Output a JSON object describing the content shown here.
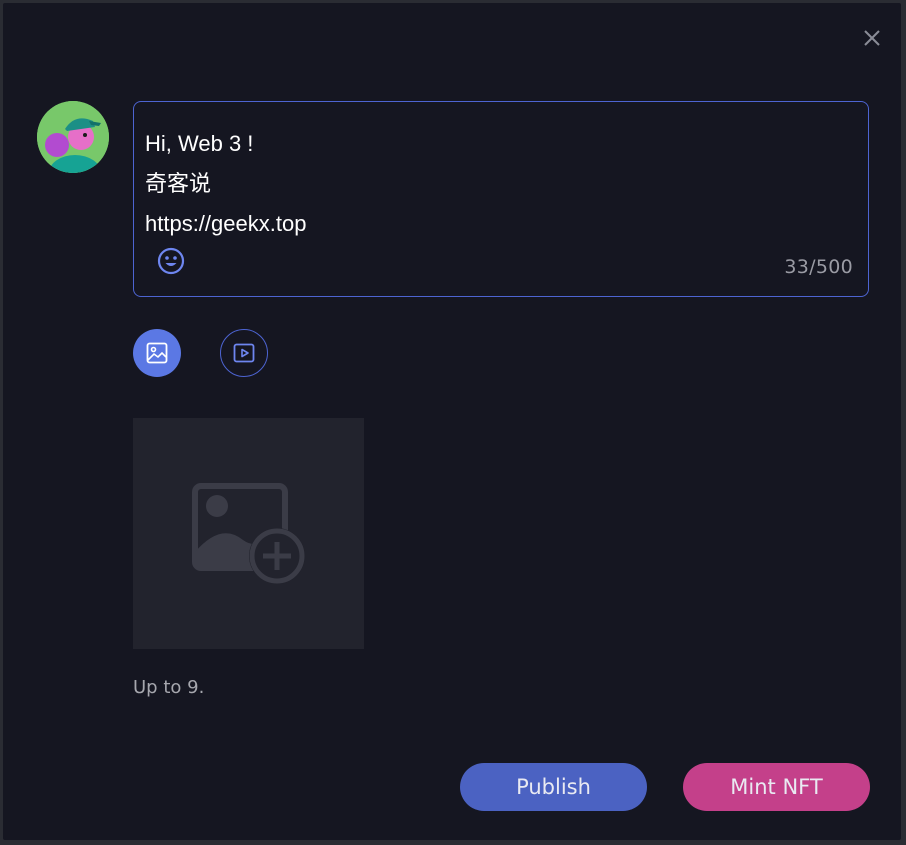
{
  "dialog": {
    "close_icon": "close-icon"
  },
  "composer": {
    "lines": [
      "Hi, Web 3 !",
      "奇客说",
      "https://geekx.top"
    ],
    "text": "Hi, Web 3 !\n奇客说\nhttps://geekx.top",
    "char_count": "33/500",
    "emoji_icon": "smiley-icon"
  },
  "media_tabs": [
    {
      "name": "image",
      "icon": "image-icon",
      "active": true
    },
    {
      "name": "video",
      "icon": "video-play-icon",
      "active": false
    }
  ],
  "upload": {
    "icon": "add-image-icon",
    "hint": "Up to 9."
  },
  "actions": {
    "publish_label": "Publish",
    "mint_label": "Mint NFT"
  },
  "colors": {
    "background": "#151621",
    "accent_blue": "#4b62c2",
    "accent_pink": "#c4408a",
    "border_blue": "#4d64d2"
  }
}
